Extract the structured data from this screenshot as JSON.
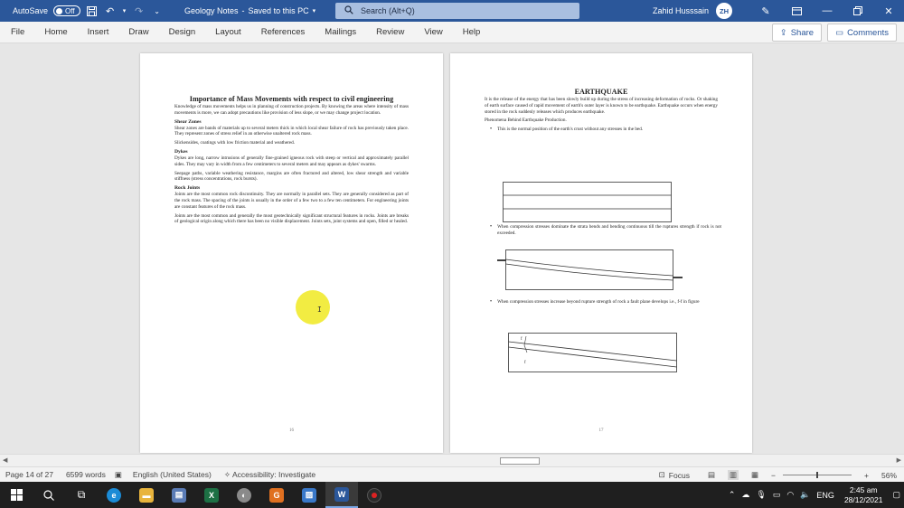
{
  "titlebar": {
    "autosave_label": "AutoSave",
    "autosave_state": "Off",
    "doc_title": "Geology Notes",
    "save_status": "Saved to this PC",
    "search_placeholder": "Search (Alt+Q)",
    "user_name": "Zahid Husssain",
    "user_initials": "ZH"
  },
  "menu": [
    "File",
    "Home",
    "Insert",
    "Draw",
    "Design",
    "Layout",
    "References",
    "Mailings",
    "Review",
    "View",
    "Help"
  ],
  "share_label": "Share",
  "comments_label": "Comments",
  "page_left": {
    "heading": "Importance of Mass Movements with respect to civil engineering",
    "intro": "Knowledge of mass movements helps us in planning of construction projects. By knowing the areas where intensity of mass movements is more, we can adopt precautions like provision of less slope, or we may change project location.",
    "shear_title": "Shear Zones",
    "shear_text": "Shear zones are bands of materials up to several meters thick in which local shear failure of rock has previously taken place. They represent zones of stress relief in an otherwise unaltered rock mass.",
    "slicken_text": "Slickensides, coatings with low friction material and weathered.",
    "dykes_title": "Dykes",
    "dykes_text": "Dykes are long, narrow intrusions of generally fine-grained igneous rock with steep or vertical and approximately parallel sides. They may vary in width from a few centimeters to several meters and may appears as dykes' swarms.",
    "seepage_text": "Seepage paths, variable weathering resistance, margins are often fractured and altered, low shear strength and variable stiffness (stress concentrations, rock bursts).",
    "joints_title": "Rock Joints",
    "joints_text": "Joints are the most common rock discontinuity. They are normally in parallel sets. They are generally considered as part of the rock mass. The spacing of the joints is usually in the order of a few two to a few ten centimeters. For engineering joints are constant features of the rock mass.",
    "joints_text2": "Joints are the most common and generally the most geotechnically significant structural features in rocks. Joints are breaks of geological origin along which there has been no visible displacement. Joints sets, joint systems and open, filled or healed.",
    "page_number": "16"
  },
  "page_right": {
    "heading": "EARTHQUAKE",
    "intro": "It is the release of the energy that has been slowly build up during the stress of increasing deformation of rocks. Or shaking of earth surface caused of rapid movement of earth's outer layer is known to be earthquake. Earthquake occurs when energy stored in the rock suddenly releases which produces earthquake.",
    "phenomena": "Phenomena Behind Earthquake Production.",
    "bullet1": "This is the normal position of the earth's crust without any stresses in the bed.",
    "bullet2": "When compression stresses dominate the strata bends and bending continuous till the ruptures strength if rock is not exceeded.",
    "bullet3": "When compression stresses increase beyond rupture strength of rock a fault plane develops i.e., f-f in figure",
    "fig_label_top": "f",
    "fig_label_bottom": "f",
    "page_number": "17"
  },
  "status": {
    "page": "Page 14 of 27",
    "words": "6599 words",
    "language": "English (United States)",
    "accessibility": "Accessibility: Investigate",
    "focus": "Focus",
    "zoom": "56%"
  },
  "taskbar": {
    "time": "2:45 am",
    "date": "28/12/2021",
    "lang": "ENG"
  }
}
